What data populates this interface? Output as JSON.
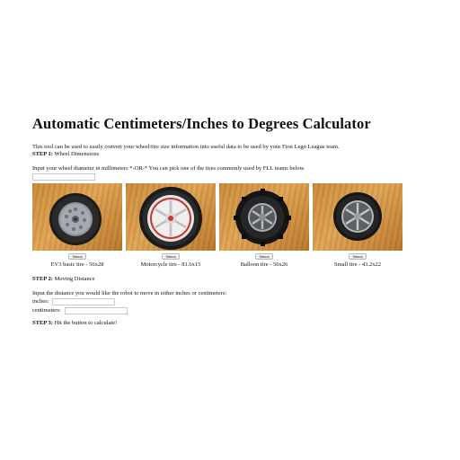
{
  "page": {
    "title": "Automatic Centimeters/Inches to Degrees Calculator",
    "intro": "This tool can be used to easily convert your wheel/tire size information into useful data to be used by your First Lego League team.",
    "step1_label": "STEP 1:",
    "step1_text": "Wheel Dimensions",
    "diameter_prompt": "Input your wheel diameter in millimeters *-OR-* You can pick one of the tires commonly used by FLL teams below.",
    "diameter_value": "",
    "step2_label": "STEP 2:",
    "step2_text": "Moving Distance",
    "distance_prompt": "Input the distance you would like the robot to move in either inches or centimeters:",
    "inches_label": "inches:",
    "inches_value": "",
    "cm_label": "centimeters:",
    "cm_value": "",
    "step3_label": "STEP 3:",
    "step3_text": "Hit the button to calculate!"
  },
  "tires": [
    {
      "caption": "EV3 basic tire - 56x28",
      "button": "Select",
      "icon": "ev3-basic-tire-photo"
    },
    {
      "caption": "Motorcycle tire - 81.6x15",
      "button": "Select",
      "icon": "motorcycle-tire-photo"
    },
    {
      "caption": "Balloon tire - 56x26",
      "button": "Select",
      "icon": "balloon-tire-photo"
    },
    {
      "caption": "Small tire - 43.2x22",
      "button": "Select",
      "icon": "small-tire-photo"
    }
  ],
  "colors": {
    "wood": "#d99a48",
    "tire_rubber": "#1c1c1c",
    "hub_gray": "#8d9399",
    "hub_white": "#e8e8e8",
    "hub_red": "#c8372f"
  }
}
